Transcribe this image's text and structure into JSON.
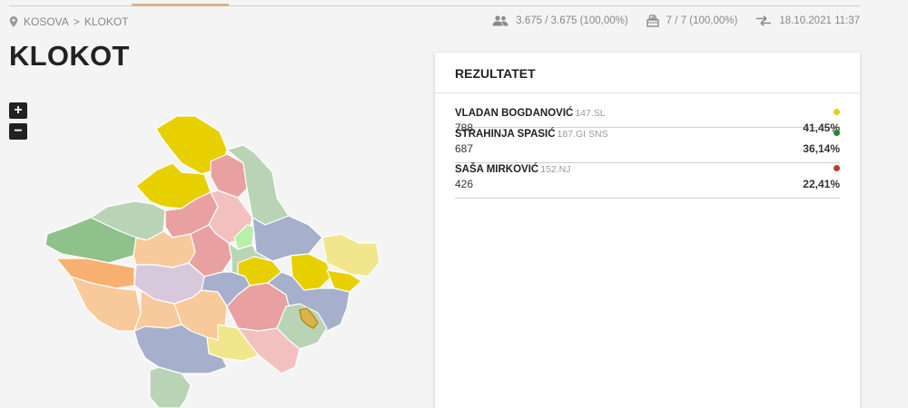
{
  "breadcrumb": {
    "root": "KOSOVA",
    "current": "KLOKOT"
  },
  "stats": {
    "voters": "3.675 / 3.675 (100,00%)",
    "stations": "7 / 7 (100,00%)",
    "updated": "18.10.2021 11:37"
  },
  "title": "KLOKOT",
  "map": {
    "zoom_in": "+",
    "zoom_out": "−"
  },
  "results": {
    "header": "REZULTATET",
    "candidates": [
      {
        "name": "VLADAN BOGDANOVIĆ",
        "party": "147.SL",
        "votes": "788",
        "percent": "41,45%",
        "color": "#e6cf00"
      },
      {
        "name": "STRAHINJA SPASIĆ",
        "party": "187.GI SNS",
        "votes": "687",
        "percent": "36,14%",
        "color": "#1f8a2e"
      },
      {
        "name": "SAŠA MIRKOVIĆ",
        "party": "152.NJ",
        "votes": "426",
        "percent": "22,41%",
        "color": "#c0392b"
      }
    ]
  }
}
